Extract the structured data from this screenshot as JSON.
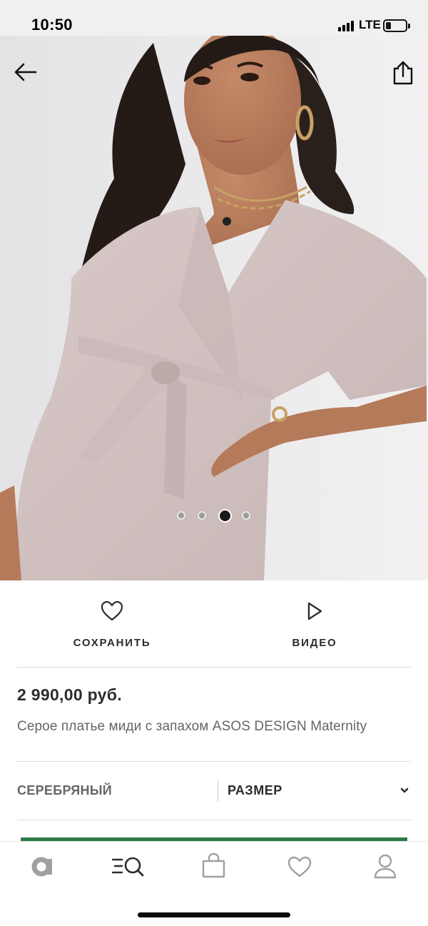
{
  "status_bar": {
    "time": "10:50",
    "network": "LTE"
  },
  "product": {
    "image": {
      "slide_count": 4,
      "active_slide": 3
    },
    "save_label": "СОХРАНИТЬ",
    "video_label": "ВИДЕО",
    "price": "2 990,00 руб.",
    "name": "Серое платье миди с запахом ASOS DESIGN Maternity",
    "color": "СЕРЕБРЯНЫЙ",
    "size_label": "РАЗМЕР"
  },
  "icons": {
    "back": "arrow-left-icon",
    "share": "share-icon",
    "save": "heart-outline-icon",
    "video": "play-outline-icon",
    "size_dropdown": "chevron-down-icon"
  },
  "tab_bar": {
    "items": [
      {
        "icon": "asos-logo-icon",
        "active": false
      },
      {
        "icon": "search-icon",
        "active": true
      },
      {
        "icon": "bag-icon",
        "active": false
      },
      {
        "icon": "heart-icon",
        "active": false
      },
      {
        "icon": "user-icon",
        "active": false
      }
    ]
  },
  "colors": {
    "accent_green": "#2f7b48",
    "dress": "#d2c3c3",
    "text_dark": "#2d2d2d",
    "text_grey": "#666666"
  }
}
